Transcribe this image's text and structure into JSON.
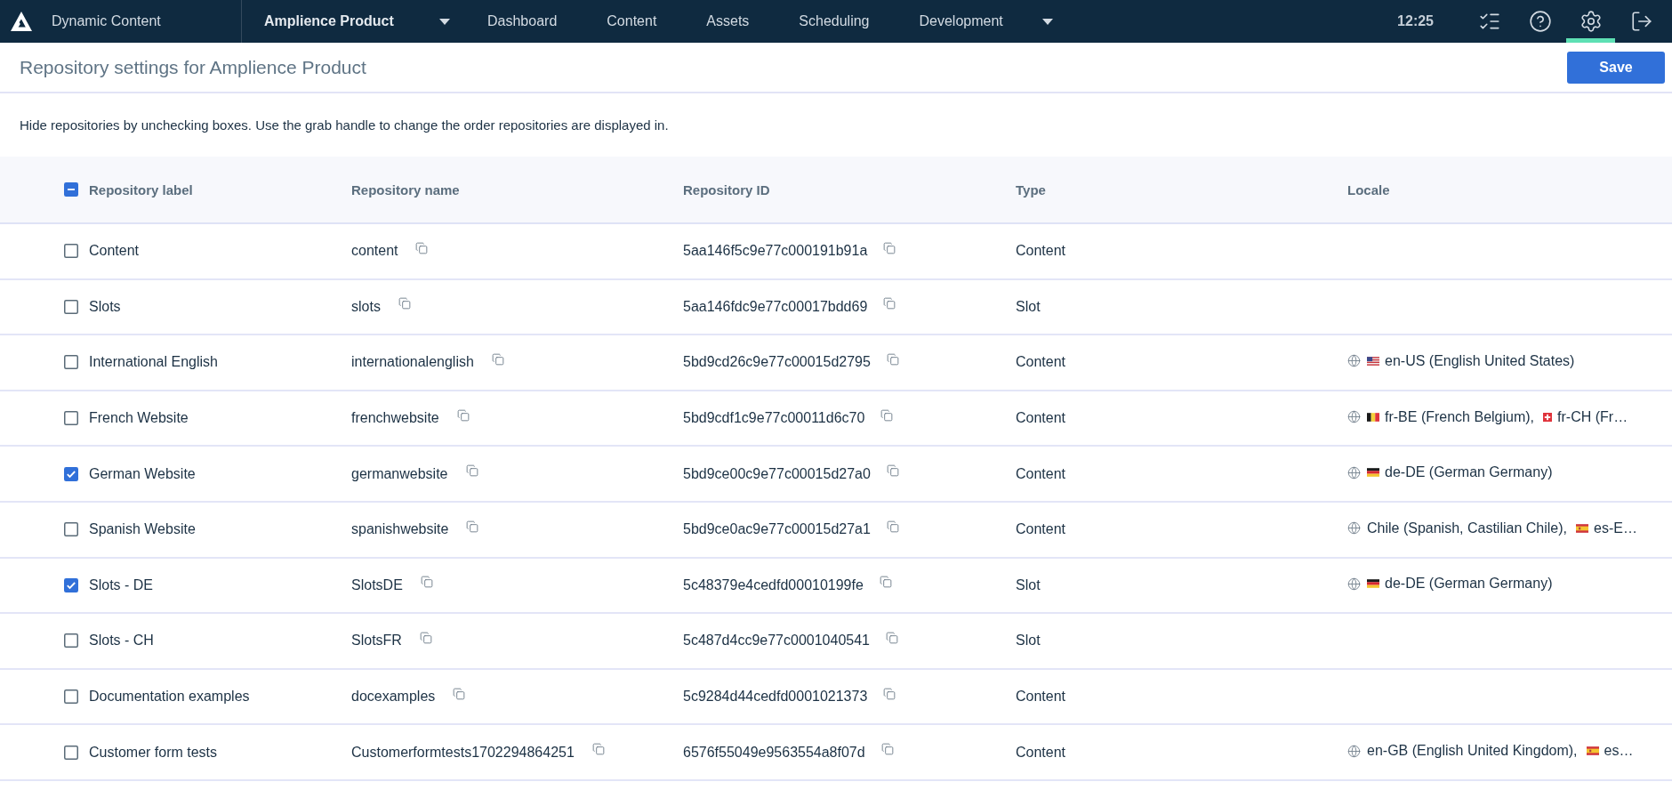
{
  "nav": {
    "app_name": "Dynamic Content",
    "hub": "Amplience Product",
    "links": [
      {
        "label": "Dashboard",
        "dropdown": false
      },
      {
        "label": "Content",
        "dropdown": false
      },
      {
        "label": "Assets",
        "dropdown": false
      },
      {
        "label": "Scheduling",
        "dropdown": false
      },
      {
        "label": "Development",
        "dropdown": true
      }
    ],
    "time": "12:25",
    "tools": [
      {
        "kind": "tasks",
        "selected": false
      },
      {
        "kind": "help",
        "selected": false
      },
      {
        "kind": "settings",
        "selected": true
      },
      {
        "kind": "logout",
        "selected": false
      }
    ]
  },
  "header": {
    "title": "Repository settings for Amplience Product",
    "save_button": "Save"
  },
  "instructions": "Hide repositories by unchecking boxes. Use the grab handle to change the order repositories are displayed in.",
  "table": {
    "select_all": {
      "indeterminate": true
    },
    "columns": [
      "Repository label",
      "Repository name",
      "Repository ID",
      "Type",
      "Locale"
    ],
    "rows": [
      {
        "label": "Content",
        "checked": false,
        "name": "content",
        "id": "5aa146f5c9e77c000191b91a",
        "type": "Content"
      },
      {
        "label": "Slots",
        "checked": false,
        "name": "slots",
        "id": "5aa146fdc9e77c00017bdd69",
        "type": "Slot"
      },
      {
        "label": "International English",
        "checked": false,
        "name": "internationalenglish",
        "id": "5bd9cd26c9e77c00015d2795",
        "type": "Content",
        "locales": [
          {
            "kind": "us",
            "text": "en-US (English United States)"
          }
        ]
      },
      {
        "label": "French Website",
        "checked": false,
        "name": "frenchwebsite",
        "id": "5bd9cdf1c9e77c00011d6c70",
        "type": "Content",
        "locales": [
          {
            "kind": "be",
            "text": "fr-BE (French Belgium),"
          },
          {
            "kind": "ch",
            "text": "fr-CH (Fr…"
          }
        ]
      },
      {
        "label": "German Website",
        "checked": true,
        "name": "germanwebsite",
        "id": "5bd9ce00c9e77c00015d27a0",
        "type": "Content",
        "locales": [
          {
            "kind": "de",
            "text": "de-DE (German Germany)"
          }
        ]
      },
      {
        "label": "Spanish Website",
        "checked": false,
        "name": "spanishwebsite",
        "id": "5bd9ce0ac9e77c00015d27a1",
        "type": "Content",
        "locales": [
          {
            "kind": "plain",
            "text": "Chile (Spanish, Castilian Chile),"
          },
          {
            "kind": "es",
            "text": "es-E…"
          }
        ]
      },
      {
        "label": "Slots - DE",
        "checked": true,
        "name": "SlotsDE",
        "id": "5c48379e4cedfd00010199fe",
        "type": "Slot",
        "locales": [
          {
            "kind": "de",
            "text": "de-DE (German Germany)"
          }
        ]
      },
      {
        "label": "Slots - CH",
        "checked": false,
        "name": "SlotsFR",
        "id": "5c487d4cc9e77c0001040541",
        "type": "Slot"
      },
      {
        "label": "Documentation examples",
        "checked": false,
        "name": "docexamples",
        "id": "5c9284d44cedfd0001021373",
        "type": "Content"
      },
      {
        "label": "Customer form tests",
        "checked": false,
        "name": "Customerformtests1702294864251",
        "id": "6576f55049e9563554a8f07d",
        "type": "Content",
        "locales": [
          {
            "kind": "plain",
            "text": "en-GB (English United Kingdom),"
          },
          {
            "kind": "es",
            "text": "es…"
          }
        ]
      }
    ]
  }
}
